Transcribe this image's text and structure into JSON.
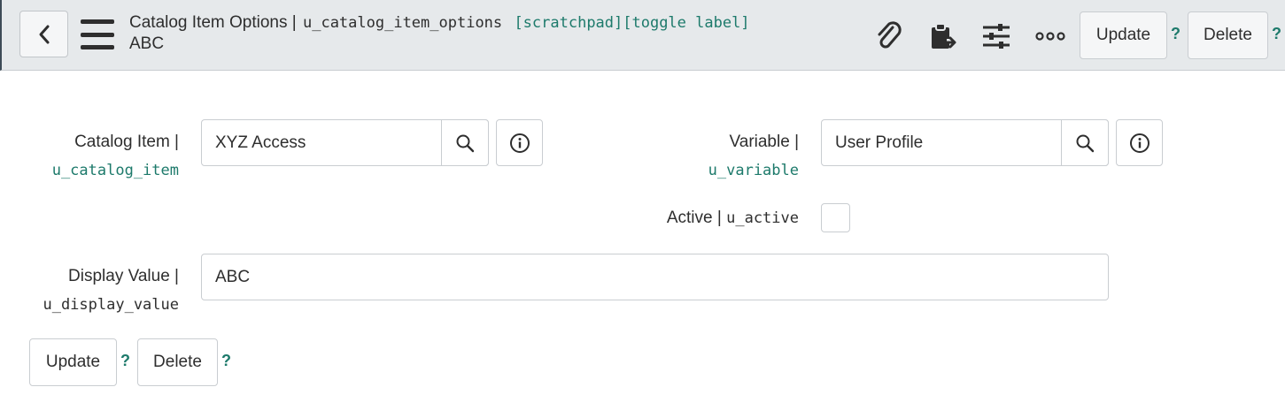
{
  "header": {
    "title": "Catalog Item Options |",
    "table_name": "u_catalog_item_options",
    "tags": "[scratchpad][toggle label]",
    "subtitle": "ABC",
    "icons": [
      "back-icon",
      "menu-icon",
      "paperclip-icon",
      "clipboard-export-icon",
      "sliders-icon",
      "more-icon"
    ],
    "update_label": "Update",
    "delete_label": "Delete",
    "help_mark": "?"
  },
  "form": {
    "catalog_item": {
      "label": "Catalog Item |",
      "field": "u_catalog_item",
      "value": "XYZ Access"
    },
    "variable": {
      "label": "Variable |",
      "field": "u_variable",
      "value": "User Profile"
    },
    "active": {
      "label": "Active |",
      "field": "u_active",
      "checked": false
    },
    "display_value": {
      "label": "Display Value |",
      "field": "u_display_value",
      "value": "ABC"
    }
  },
  "footer": {
    "update_label": "Update",
    "delete_label": "Delete",
    "help_mark": "?"
  },
  "colors": {
    "accent_teal": "#1d7a6b",
    "header_bg": "#e6e9eb",
    "border": "#c9cdd1"
  }
}
